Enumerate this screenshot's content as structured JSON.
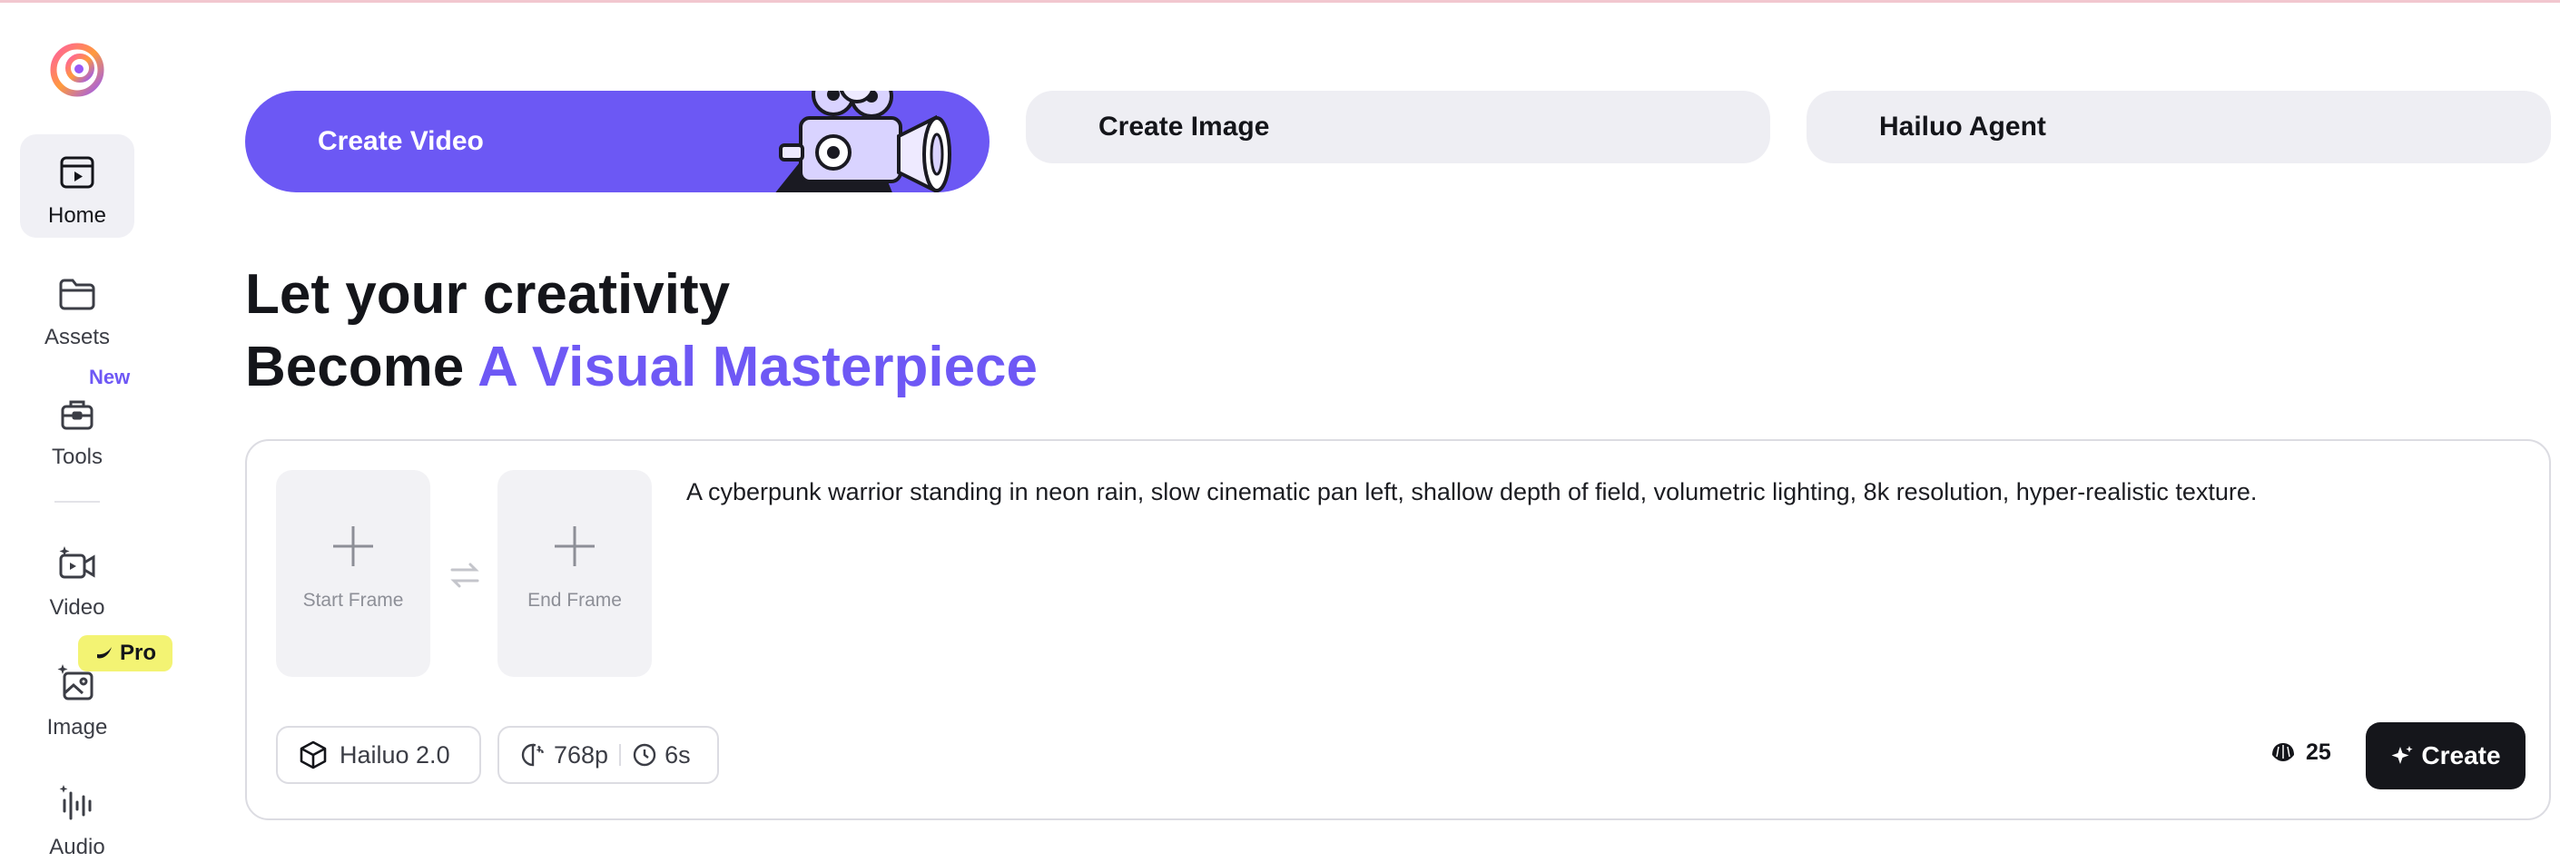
{
  "sidebar": {
    "items": [
      {
        "label": "Home",
        "icon": "home-icon",
        "active": true
      },
      {
        "label": "Assets",
        "icon": "folder-icon"
      },
      {
        "label": "Tools",
        "icon": "toolbox-icon",
        "badge": "New"
      },
      {
        "label": "Video",
        "icon": "video-icon"
      },
      {
        "label": "Image",
        "icon": "image-icon",
        "badge": "Pro"
      },
      {
        "label": "Audio",
        "icon": "audio-waveform-icon"
      }
    ]
  },
  "tabs": {
    "video": "Create Video",
    "image": "Create Image",
    "agent": "Hailuo Agent"
  },
  "headline": {
    "line1": "Let your creativity",
    "line2_prefix": "Become ",
    "line2_accent": "A Visual Masterpiece"
  },
  "card": {
    "start_frame": "Start Frame",
    "end_frame": "End Frame",
    "prompt": "A cyberpunk warrior standing in neon rain, slow cinematic pan left, shallow depth of field, volumetric lighting, 8k resolution, hyper-realistic texture.",
    "model": "Hailuo 2.0",
    "resolution": "768p",
    "duration": "6s",
    "credits": "25",
    "create_label": "Create"
  },
  "colors": {
    "accent": "#6c58f4",
    "dark_button": "#15161b",
    "pro_badge": "#f3f373",
    "tab_bg": "#eeeef3"
  }
}
